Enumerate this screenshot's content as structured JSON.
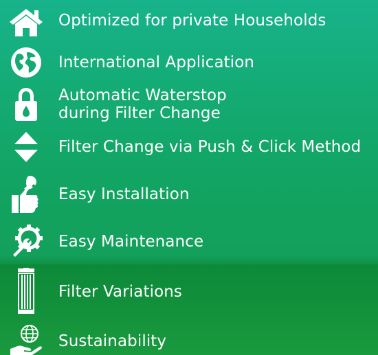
{
  "features": [
    {
      "label": "Optimized for private Households",
      "icon": "house-icon"
    },
    {
      "label": "International Application",
      "icon": "globe-icon"
    },
    {
      "label_line1": "Automatic Waterstop",
      "label_line2": "during Filter Change",
      "icon": "padlock-drop-icon"
    },
    {
      "label": "Filter Change via Push & Click Method",
      "icon": "up-down-arrows-icon"
    },
    {
      "label": "Easy Installation",
      "icon": "thumbs-up-wrench-icon"
    },
    {
      "label": "Easy Maintenance",
      "icon": "gear-wrench-icon"
    },
    {
      "label": "Filter Variations",
      "icon": "filter-cartridge-icon"
    },
    {
      "label": "Sustainability",
      "icon": "hand-globe-icon"
    }
  ],
  "colors": {
    "background_top": "#17b38b",
    "background_bottom": "#138f3b",
    "text": "#ffffff"
  }
}
